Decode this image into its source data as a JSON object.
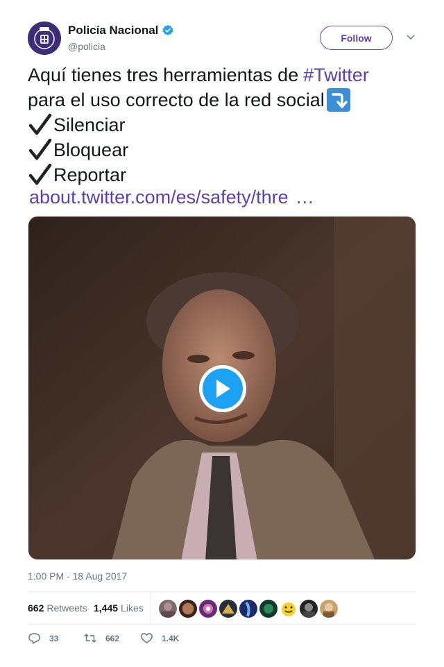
{
  "user": {
    "display_name": "Policía Nacional",
    "handle": "@policia",
    "verified": true,
    "avatar_icon": "police-badge-icon",
    "avatar_color": "#3b2d7a"
  },
  "follow_button": {
    "label": "Follow",
    "color": "#5b3fb0"
  },
  "tweet": {
    "line1_prefix": "Aquí tienes tres herramientas de",
    "hashtag": "#Twitter",
    "line2": "para el uso correcto de la red social",
    "items": [
      "Silenciar",
      "Bloquear",
      "Reportar"
    ],
    "link_text": "about.twitter.com/es/safety/thre",
    "link_ellipsis": "…",
    "link_color": "#5b3fb0"
  },
  "media": {
    "type": "gif",
    "play_icon": "play-icon"
  },
  "timestamp": "1:00 PM - 18 Aug 2017",
  "stats": {
    "retweets_count": "662",
    "retweets_label": "Retweets",
    "likes_count": "1,445",
    "likes_label": "Likes"
  },
  "actions": {
    "replies": "33",
    "retweets": "662",
    "likes": "1.4K"
  }
}
